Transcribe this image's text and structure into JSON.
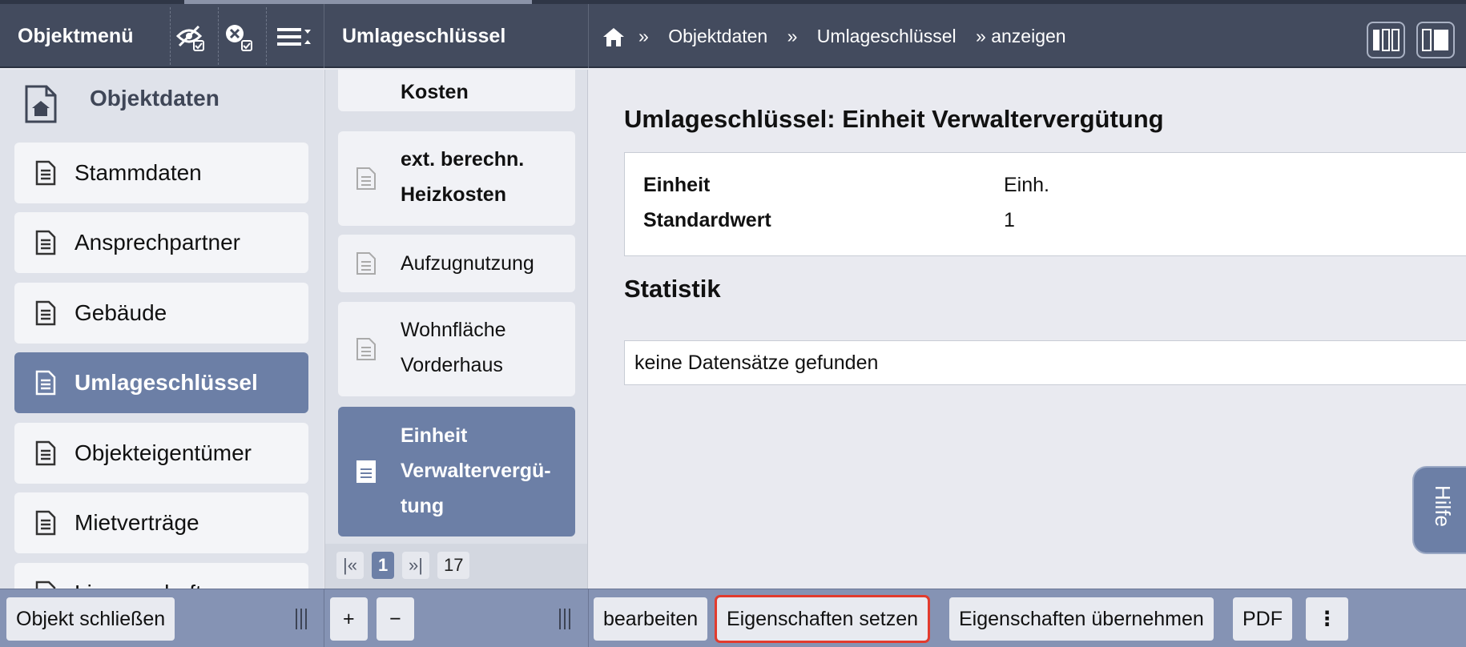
{
  "header": {
    "object_menu": "Objektmenü",
    "panel_title": "Umlageschlüssel",
    "breadcrumb": [
      "Objektdaten",
      "Umlageschlüssel",
      "» anzeigen"
    ],
    "breadcrumb_sep": "»"
  },
  "sidebar": {
    "title": "Objektdaten",
    "items": [
      {
        "label": "Stammdaten"
      },
      {
        "label": "Ansprechpartner"
      },
      {
        "label": "Gebäude"
      },
      {
        "label": "Umlageschlüssel"
      },
      {
        "label": "Objekteigentümer"
      },
      {
        "label": "Mietverträge"
      },
      {
        "label": "Liegenschaften"
      }
    ]
  },
  "keys_list": {
    "items": [
      {
        "line1": "Kosten",
        "line2": ""
      },
      {
        "line1": "ext. berechn.",
        "line2": "Heizkosten"
      },
      {
        "line1": "Aufzugnutzung",
        "line2": ""
      },
      {
        "line1": "Wohnfläche",
        "line2": "Vorderhaus"
      },
      {
        "line1": "Einheit",
        "line2": "Verwaltervergü-",
        "line3": "tung"
      }
    ],
    "pager": {
      "first": "|«",
      "current": "1",
      "last": "»|",
      "total": "17"
    }
  },
  "content": {
    "title": "Umlageschlüssel: Einheit Verwaltervergütung",
    "properties": [
      {
        "key": "Einheit",
        "value": "Einh."
      },
      {
        "key": "Standardwert",
        "value": "1"
      }
    ],
    "stats_title": "Statistik",
    "stats_empty": "keine Datensätze gefunden",
    "help": "Hilfe"
  },
  "footer": {
    "close_object": "Objekt schließen",
    "add": "+",
    "remove": "−",
    "edit": "bearbeiten",
    "set_properties": "Eigenschaften setzen",
    "adopt_properties": "Eigenschaften übernehmen",
    "pdf": "PDF",
    "more": "⋮"
  },
  "colors": {
    "header": "#434b5e",
    "active": "#6c7fa6",
    "highlight": "#e23b2e"
  }
}
